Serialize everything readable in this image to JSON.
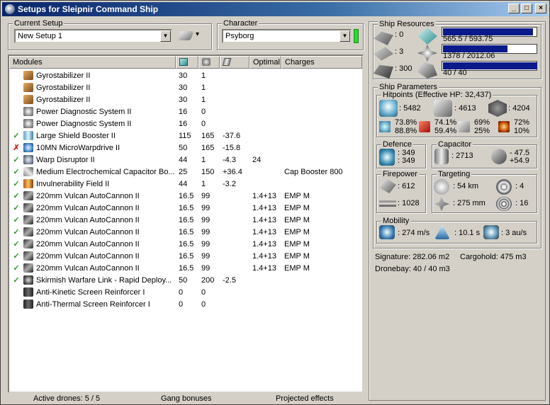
{
  "window": {
    "title": "Setups for Sleipnir Command Ship",
    "btn_min": "_",
    "btn_max": "□",
    "btn_close": "×"
  },
  "current_setup": {
    "label": "Current Setup",
    "value": "New Setup 1",
    "arrow": "▼",
    "tool_arrow": "▾"
  },
  "character": {
    "label": "Character",
    "value": "Psyborg",
    "arrow": "▼"
  },
  "modules": {
    "headers": {
      "name": "Modules",
      "optimal": "Optimal",
      "charges": "Charges"
    },
    "rows": [
      {
        "status": "",
        "icon": "gyrostabilizer-icon",
        "name": "Gyrostabilizer II",
        "pg": "30",
        "cpu": "1",
        "cap": "",
        "optimal": "",
        "charges": ""
      },
      {
        "status": "",
        "icon": "gyrostabilizer-icon",
        "name": "Gyrostabilizer II",
        "pg": "30",
        "cpu": "1",
        "cap": "",
        "optimal": "",
        "charges": ""
      },
      {
        "status": "",
        "icon": "gyrostabilizer-icon",
        "name": "Gyrostabilizer II",
        "pg": "30",
        "cpu": "1",
        "cap": "",
        "optimal": "",
        "charges": ""
      },
      {
        "status": "",
        "icon": "power-diagnostic-icon",
        "name": "Power Diagnostic System II",
        "pg": "16",
        "cpu": "0",
        "cap": "",
        "optimal": "",
        "charges": ""
      },
      {
        "status": "",
        "icon": "power-diagnostic-icon",
        "name": "Power Diagnostic System II",
        "pg": "16",
        "cpu": "0",
        "cap": "",
        "optimal": "",
        "charges": ""
      },
      {
        "status": "✓",
        "icon": "shield-booster-icon",
        "name": "Large Shield Booster II",
        "pg": "115",
        "cpu": "165",
        "cap": "-37.6",
        "optimal": "",
        "charges": ""
      },
      {
        "status": "✗",
        "icon": "microwarpdrive-icon",
        "name": "10MN MicroWarpdrive II",
        "pg": "50",
        "cpu": "165",
        "cap": "-15.8",
        "optimal": "",
        "charges": ""
      },
      {
        "status": "✓",
        "icon": "warp-disruptor-icon",
        "name": "Warp Disruptor II",
        "pg": "44",
        "cpu": "1",
        "cap": "-4.3",
        "optimal": "24",
        "charges": ""
      },
      {
        "status": "✓",
        "icon": "capacitor-booster-icon",
        "name": "Medium Electrochemical Capacitor Bo...",
        "pg": "25",
        "cpu": "150",
        "cap": "+36.4",
        "optimal": "",
        "charges": "Cap Booster 800"
      },
      {
        "status": "✓",
        "icon": "invulnerability-field-icon",
        "name": "Invulnerability Field II",
        "pg": "44",
        "cpu": "1",
        "cap": "-3.2",
        "optimal": "",
        "charges": ""
      },
      {
        "status": "✓",
        "icon": "autocannon-icon",
        "name": "220mm Vulcan AutoCannon II",
        "pg": "16.5",
        "cpu": "99",
        "cap": "",
        "optimal": "1.4+13",
        "charges": "EMP M"
      },
      {
        "status": "✓",
        "icon": "autocannon-icon",
        "name": "220mm Vulcan AutoCannon II",
        "pg": "16.5",
        "cpu": "99",
        "cap": "",
        "optimal": "1.4+13",
        "charges": "EMP M"
      },
      {
        "status": "✓",
        "icon": "autocannon-icon",
        "name": "220mm Vulcan AutoCannon II",
        "pg": "16.5",
        "cpu": "99",
        "cap": "",
        "optimal": "1.4+13",
        "charges": "EMP M"
      },
      {
        "status": "✓",
        "icon": "autocannon-icon",
        "name": "220mm Vulcan AutoCannon II",
        "pg": "16.5",
        "cpu": "99",
        "cap": "",
        "optimal": "1.4+13",
        "charges": "EMP M"
      },
      {
        "status": "✓",
        "icon": "autocannon-icon",
        "name": "220mm Vulcan AutoCannon II",
        "pg": "16.5",
        "cpu": "99",
        "cap": "",
        "optimal": "1.4+13",
        "charges": "EMP M"
      },
      {
        "status": "✓",
        "icon": "autocannon-icon",
        "name": "220mm Vulcan AutoCannon II",
        "pg": "16.5",
        "cpu": "99",
        "cap": "",
        "optimal": "1.4+13",
        "charges": "EMP M"
      },
      {
        "status": "✓",
        "icon": "autocannon-icon",
        "name": "220mm Vulcan AutoCannon II",
        "pg": "16.5",
        "cpu": "99",
        "cap": "",
        "optimal": "1.4+13",
        "charges": "EMP M"
      },
      {
        "status": "✓",
        "icon": "warfare-link-icon",
        "name": "Skirmish Warfare Link - Rapid Deploy...",
        "pg": "50",
        "cpu": "200",
        "cap": "-2.5",
        "optimal": "",
        "charges": ""
      },
      {
        "status": "",
        "icon": "screen-reinforcer-icon",
        "name": "Anti-Kinetic Screen Reinforcer I",
        "pg": "0",
        "cpu": "0",
        "cap": "",
        "optimal": "",
        "charges": ""
      },
      {
        "status": "",
        "icon": "screen-reinforcer-icon",
        "name": "Anti-Thermal Screen Reinforcer I",
        "pg": "0",
        "cpu": "0",
        "cap": "",
        "optimal": "",
        "charges": ""
      }
    ]
  },
  "status_bar": {
    "drones": "Active drones: 5 / 5",
    "gang": "Gang bonuses",
    "projected": "Projected effects"
  },
  "ship_resources": {
    "label": "Ship Resources",
    "turret_slots": ": 0",
    "launcher_slots": ": 3",
    "calibration": ": 300",
    "powergrid": "565.5 / 593.75",
    "cpu": "1378 / 2012.06",
    "drone_bandwidth": "40 / 40",
    "powergrid_fill": 0.952,
    "cpu_fill": 0.685,
    "bandwidth_fill": 1.0
  },
  "ship_parameters": {
    "label": "Ship Parameters",
    "hitpoints_label": "Hitpoints (Effective HP: 32,437)",
    "shield_hp": ": 5482",
    "armor_hp": ": 4613",
    "structure_hp": ": 4204",
    "em_res": [
      "73.8%",
      "88.8%"
    ],
    "thermal_res": [
      "74.1%",
      "59.4%"
    ],
    "kinetic_res": [
      "69%",
      "25%"
    ],
    "explosive_res": [
      "72%",
      "10%"
    ],
    "defence_label": "Defence",
    "defence": [
      ": 349",
      ": 349"
    ],
    "capacitor_label": "Capacitor",
    "capacitor_capacity": ": 2713",
    "capacitor_delta": [
      "- 47.5",
      "+54.9"
    ],
    "firepower_label": "Firepower",
    "turret_dps": ": 612",
    "missile_dps": ": 1028",
    "targeting_label": "Targeting",
    "target_range": ": 54 km",
    "max_targets": ": 4",
    "scan_resolution": ": 275 mm",
    "sensor_strength": ": 16",
    "mobility_label": "Mobility",
    "velocity": ": 274 m/s",
    "align_time": ": 10.1 s",
    "warp_speed": ": 3 au/s",
    "signature": "Signature: 282.06 m2",
    "cargohold": "Cargohold: 475 m3",
    "dronebay": "Dronebay: 40 / 40 m3"
  }
}
